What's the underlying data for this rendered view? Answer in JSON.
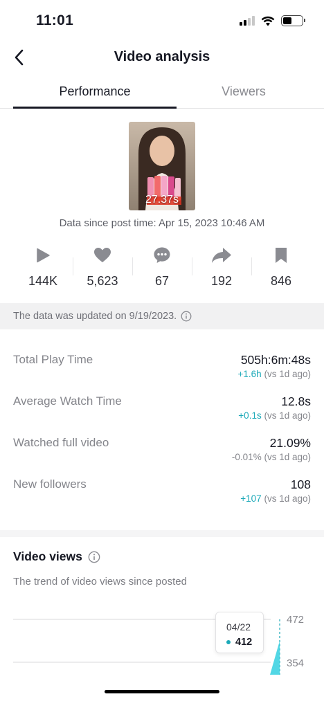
{
  "status_bar": {
    "time": "11:01",
    "battery_level": 0.45
  },
  "nav": {
    "title": "Video analysis"
  },
  "tabs": [
    {
      "label": "Performance",
      "active": true
    },
    {
      "label": "Viewers",
      "active": false
    }
  ],
  "video": {
    "duration": "27.37s",
    "post_time_text": "Data since post time: Apr 15, 2023 10:46 AM"
  },
  "stats": [
    {
      "icon": "play-icon",
      "value": "144K"
    },
    {
      "icon": "heart-icon",
      "value": "5,623"
    },
    {
      "icon": "comment-icon",
      "value": "67"
    },
    {
      "icon": "share-icon",
      "value": "192"
    },
    {
      "icon": "bookmark-icon",
      "value": "846"
    }
  ],
  "update_banner": {
    "text": "The data was updated on 9/19/2023."
  },
  "metrics": [
    {
      "label": "Total Play Time",
      "value": "505h:6m:48s",
      "delta": "+1.6h",
      "suffix": " (vs 1d ago)"
    },
    {
      "label": "Average Watch Time",
      "value": "12.8s",
      "delta": "+0.1s",
      "suffix": " (vs 1d ago)"
    },
    {
      "label": "Watched full video",
      "value": "21.09%",
      "delta": "-0.01%",
      "suffix": " (vs 1d ago)"
    },
    {
      "label": "New followers",
      "value": "108",
      "delta": "+107",
      "suffix": " (vs 1d ago)"
    }
  ],
  "video_views": {
    "title": "Video views",
    "subtitle": "The trend of video views since posted",
    "y_ticks": [
      "472",
      "354"
    ],
    "tooltip": {
      "date": "04/22",
      "value": "412"
    }
  },
  "colors": {
    "accent": "#1ba9b8",
    "text": "#161823",
    "muted": "#85868c"
  }
}
